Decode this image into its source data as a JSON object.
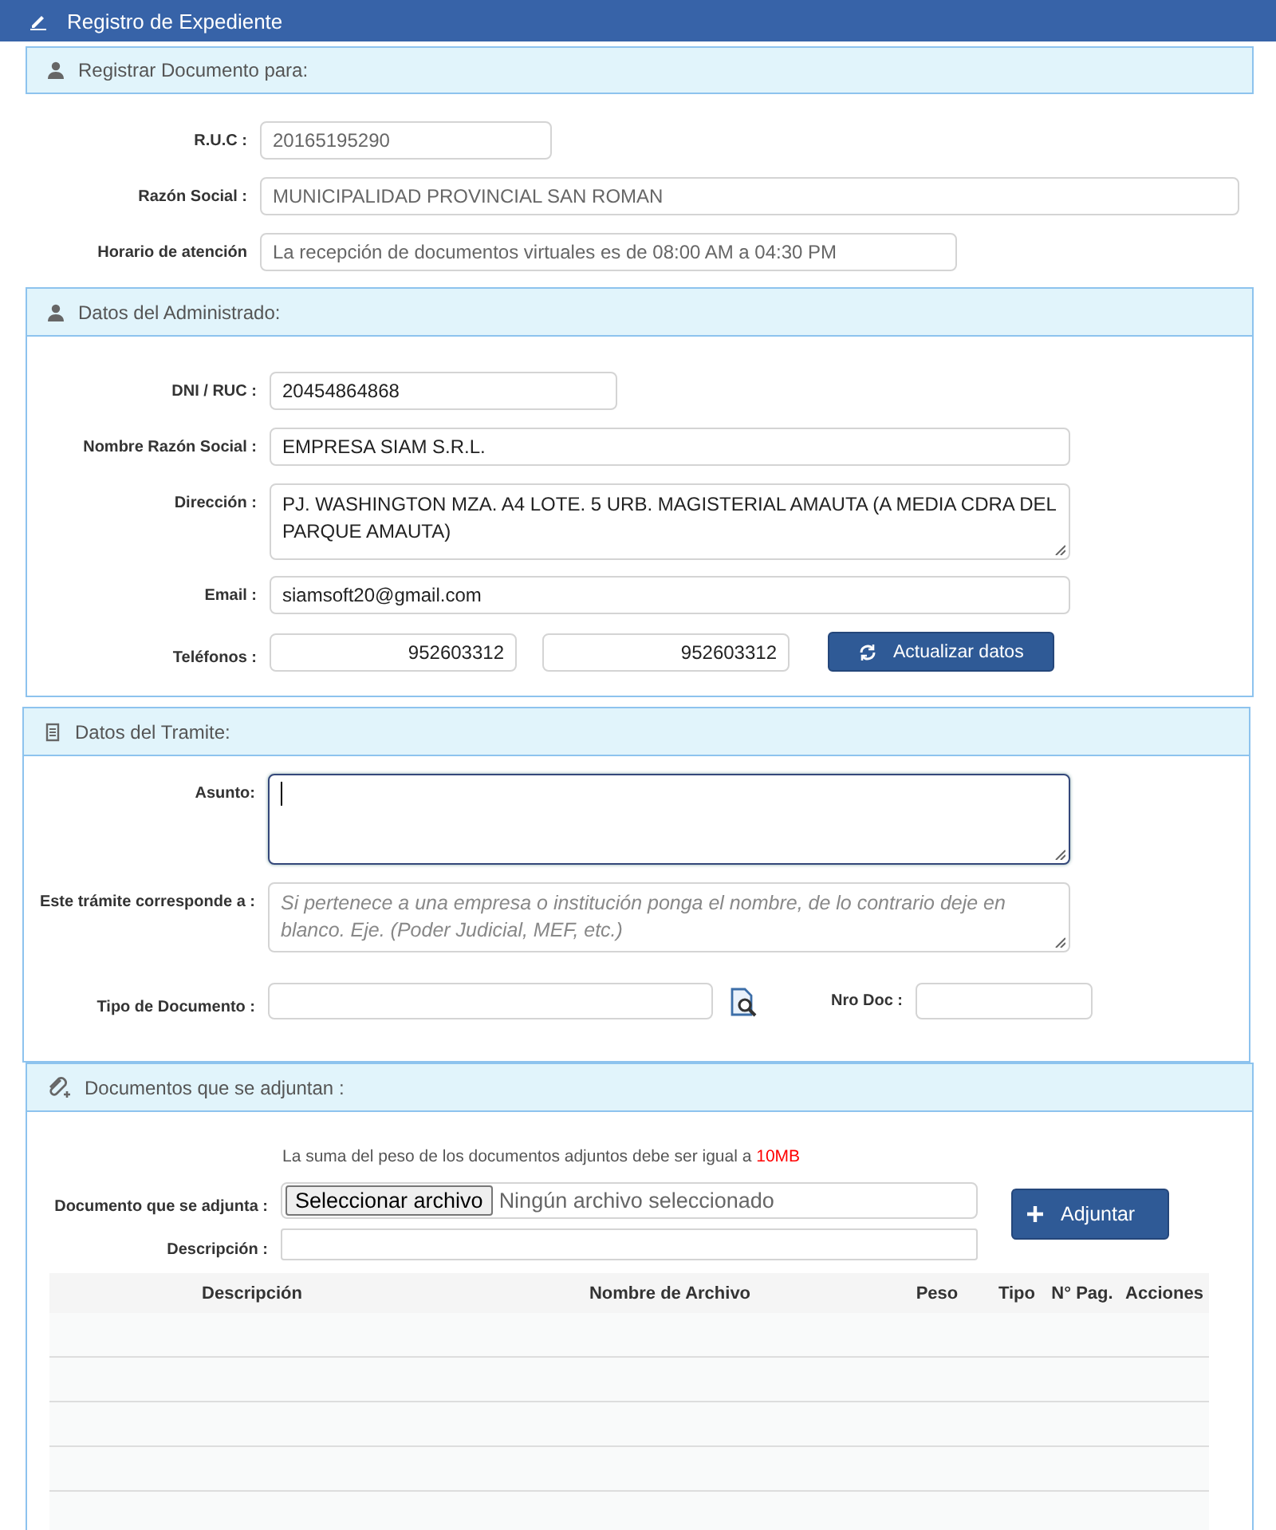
{
  "window": {
    "title": "Registro de Expediente"
  },
  "registrar": {
    "title": "Registrar Documento para:",
    "fields": [
      {
        "label": "R.U.C :",
        "value": "20165195290"
      },
      {
        "label": "Razón Social :",
        "value": "MUNICIPALIDAD PROVINCIAL SAN ROMAN"
      },
      {
        "label": "Horario de atención",
        "value": "La recepción de documentos virtuales es de 08:00 AM  a 04:30 PM"
      }
    ]
  },
  "administrado": {
    "title": "Datos del Administrado:",
    "fields": [
      {
        "label": "DNI / RUC :",
        "value": "20454864868"
      },
      {
        "label": "Nombre Razón Social :",
        "value": "EMPRESA SIAM S.R.L."
      },
      {
        "label": "Dirección :",
        "value": "PJ. WASHINGTON MZA. A4 LOTE. 5 URB. MAGISTERIAL AMAUTA (A MEDIA CDRA DEL PARQUE AMAUTA)"
      },
      {
        "label": "Email :",
        "value": "siamsoft20@gmail.com"
      }
    ],
    "phones": {
      "label": "Teléfonos :",
      "values": [
        "952603312",
        "952603312"
      ]
    },
    "update_button": "Actualizar datos"
  },
  "tramite": {
    "title": "Datos del Tramite:",
    "asunto": {
      "label": "Asunto:",
      "focused": true
    },
    "corresponde": {
      "label": "Este trámite corresponde a :",
      "placeholder": "Si pertenece a una empresa o institución ponga el nombre, de lo contrario deje en blanco. Eje. (Poder Judicial, MEF, etc.)"
    },
    "tipo_documento": {
      "label": "Tipo de Documento :"
    },
    "nro_doc": {
      "label": "Nro Doc :"
    }
  },
  "adjuntos": {
    "title": "Documentos que se adjuntan :",
    "note": "La suma del peso de los documentos adjuntos debe ser igual a ",
    "note_limit": "10MB",
    "file": {
      "label": "Documento que se adjunta :",
      "button": "Seleccionar archivo",
      "status": "Ningún archivo seleccionado"
    },
    "descripcion": {
      "label": "Descripción :"
    },
    "add_button": "Adjuntar",
    "table": {
      "columns": [
        "Descripción",
        "Nombre de Archivo",
        "Peso",
        "Tipo",
        "N° Pag.",
        "Acciones"
      ]
    }
  }
}
